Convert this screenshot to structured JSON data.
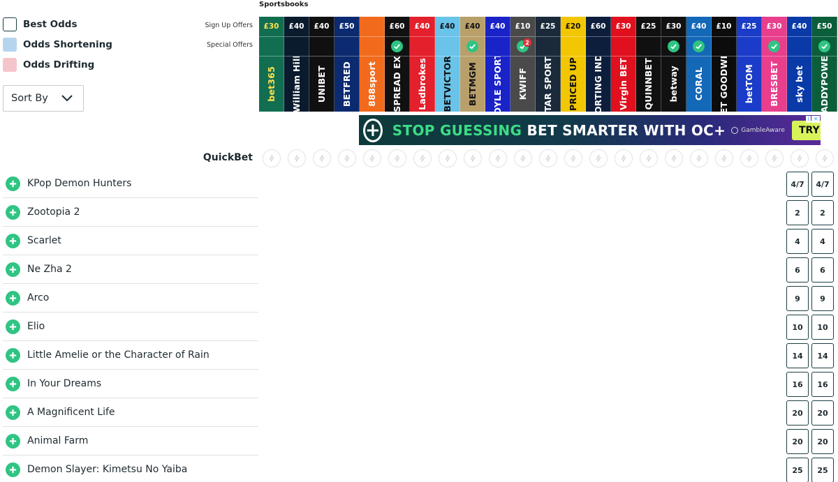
{
  "legend": {
    "best_odds": "Best Odds",
    "odds_shortening": "Odds Shortening",
    "odds_drifting": "Odds Drifting"
  },
  "sort": {
    "label": "Sort By"
  },
  "labels": {
    "sign_up_offers": "Sign Up Offers",
    "special_offers": "Special Offers",
    "sportsbooks": "Sportsbooks",
    "quickbet": "QuickBet"
  },
  "books": [
    {
      "name": "bet365",
      "offer": "£30",
      "special": false,
      "bg": "#126e51",
      "fg": "#ffe14d"
    },
    {
      "name": "William Hill",
      "offer": "£40",
      "special": false,
      "bg": "#0a1b2e",
      "fg": "#ffffff"
    },
    {
      "name": "UNIBET",
      "offer": "£40",
      "special": false,
      "bg": "#101010",
      "fg": "#ffffff"
    },
    {
      "name": "BETFRED",
      "offer": "£50",
      "special": false,
      "bg": "#0b2a6f",
      "fg": "#ffffff"
    },
    {
      "name": "888sport",
      "offer": "",
      "special": false,
      "bg": "#f26b1d",
      "fg": "#ffffff"
    },
    {
      "name": "SPREAD EX",
      "offer": "£60",
      "special": true,
      "bg": "#111111",
      "fg": "#ffffff"
    },
    {
      "name": "Ladbrokes",
      "offer": "£40",
      "special": false,
      "bg": "#e3202c",
      "fg": "#ffffff"
    },
    {
      "name": "BETVICTOR",
      "offer": "£40",
      "special": false,
      "bg": "#6ac3e9",
      "fg": "#111111"
    },
    {
      "name": "BETMGM",
      "offer": "£40",
      "special": true,
      "bg": "#b9a06a",
      "fg": "#111111"
    },
    {
      "name": "BOYLE SPORTS",
      "offer": "£40",
      "special": false,
      "bg": "#1a23c8",
      "fg": "#ffffff"
    },
    {
      "name": "KWIFF",
      "offer": "£10",
      "special": true,
      "badge": "2",
      "bg": "#4a4a4a",
      "fg": "#ffffff"
    },
    {
      "name": "STAR SPORTS",
      "offer": "£25",
      "special": false,
      "bg": "#1a2a3a",
      "fg": "#ffffff"
    },
    {
      "name": "PRICED UP",
      "offer": "£20",
      "special": false,
      "bg": "#f2c600",
      "fg": "#111111"
    },
    {
      "name": "SPORTING INDEX",
      "offer": "£60",
      "special": false,
      "bg": "#0d1e3c",
      "fg": "#ffffff"
    },
    {
      "name": "Virgin BET",
      "offer": "£30",
      "special": false,
      "bg": "#e0101e",
      "fg": "#ffffff"
    },
    {
      "name": "QUINNBET",
      "offer": "£25",
      "special": false,
      "bg": "#101010",
      "fg": "#ffffff"
    },
    {
      "name": "betway",
      "offer": "£30",
      "special": true,
      "bg": "#111111",
      "fg": "#ffffff"
    },
    {
      "name": "CORAL",
      "offer": "£40",
      "special": true,
      "bg": "#1468b8",
      "fg": "#ffffff"
    },
    {
      "name": "BET GOODWIN",
      "offer": "£10",
      "special": false,
      "bg": "#0c0c0c",
      "fg": "#ffffff"
    },
    {
      "name": "betTOM",
      "offer": "£25",
      "special": false,
      "bg": "#1a3cc8",
      "fg": "#ffffff"
    },
    {
      "name": "BRESBET",
      "offer": "£30",
      "special": true,
      "bg": "#e83e8c",
      "fg": "#ffffff"
    },
    {
      "name": "sky bet",
      "offer": "£40",
      "special": false,
      "bg": "#0a3aa8",
      "fg": "#ffffff"
    },
    {
      "name": "PADDYPOWER",
      "offer": "£50",
      "special": true,
      "bg": "#0b5e3a",
      "fg": "#ffffff"
    }
  ],
  "ad": {
    "part1": "STOP GUESSING",
    "part2": "BET SMARTER WITH OC+",
    "gamble": "GambleAware",
    "cta": "TRY FOR FREE",
    "info": "i",
    "close": "×"
  },
  "selections": [
    {
      "name": "KPop Demon Hunters",
      "odds": [
        "4/7",
        "4/7"
      ]
    },
    {
      "name": "Zootopia 2",
      "odds": [
        "2",
        "2"
      ]
    },
    {
      "name": "Scarlet",
      "odds": [
        "4",
        "4"
      ]
    },
    {
      "name": "Ne Zha 2",
      "odds": [
        "6",
        "6"
      ]
    },
    {
      "name": "Arco",
      "odds": [
        "9",
        "9"
      ]
    },
    {
      "name": "Elio",
      "odds": [
        "10",
        "10"
      ]
    },
    {
      "name": "Little Amelie or the Character of Rain",
      "odds": [
        "14",
        "14"
      ]
    },
    {
      "name": "In Your Dreams",
      "odds": [
        "16",
        "16"
      ]
    },
    {
      "name": "A Magnificent Life",
      "odds": [
        "20",
        "20"
      ]
    },
    {
      "name": "Animal Farm",
      "odds": [
        "20",
        "20"
      ]
    },
    {
      "name": "Demon Slayer: Kimetsu No Yaiba",
      "odds": [
        "25",
        "25"
      ]
    }
  ]
}
